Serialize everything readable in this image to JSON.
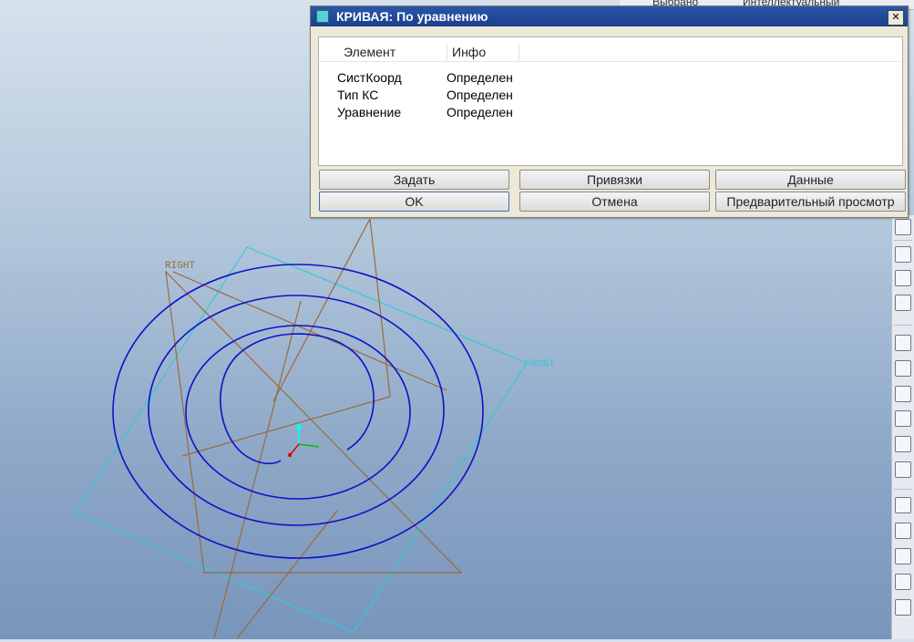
{
  "top_strip": {
    "col1": "Выбрано",
    "col2": "Интеллектуальный"
  },
  "dialog": {
    "title": "КРИВАЯ: По уравнению",
    "close_label": "✕",
    "columns": [
      "Элемент",
      "Инфо"
    ],
    "rows": [
      {
        "element": "СистКоорд",
        "info": "Определен"
      },
      {
        "element": "Тип КС",
        "info": "Определен"
      },
      {
        "element": "Уравнение",
        "info": "Определен"
      }
    ],
    "buttons": {
      "define": "Задать",
      "references": "Привязки",
      "data": "Данные",
      "ok": "OK",
      "cancel": "Отмена",
      "preview": "Предварительный просмотр"
    }
  },
  "viewport": {
    "datum_right": "RIGHT",
    "datum_front": "FRONT",
    "colors": {
      "spiral": "#1010c8",
      "plane_right": "#9a6a3a",
      "plane_front": "#35c8d8"
    }
  },
  "right_toolbar": {
    "icons": [
      "datum-plane-icon",
      "sketch-icon",
      "extrude-icon",
      "revolve-icon",
      "sweep-icon",
      "blend-icon",
      "shell-icon",
      "round-icon",
      "chamfer-icon",
      "draft-icon",
      "rib-icon",
      "pattern-icon",
      "mirror-icon",
      "merge-icon",
      "trim-icon",
      "offset-icon"
    ]
  }
}
